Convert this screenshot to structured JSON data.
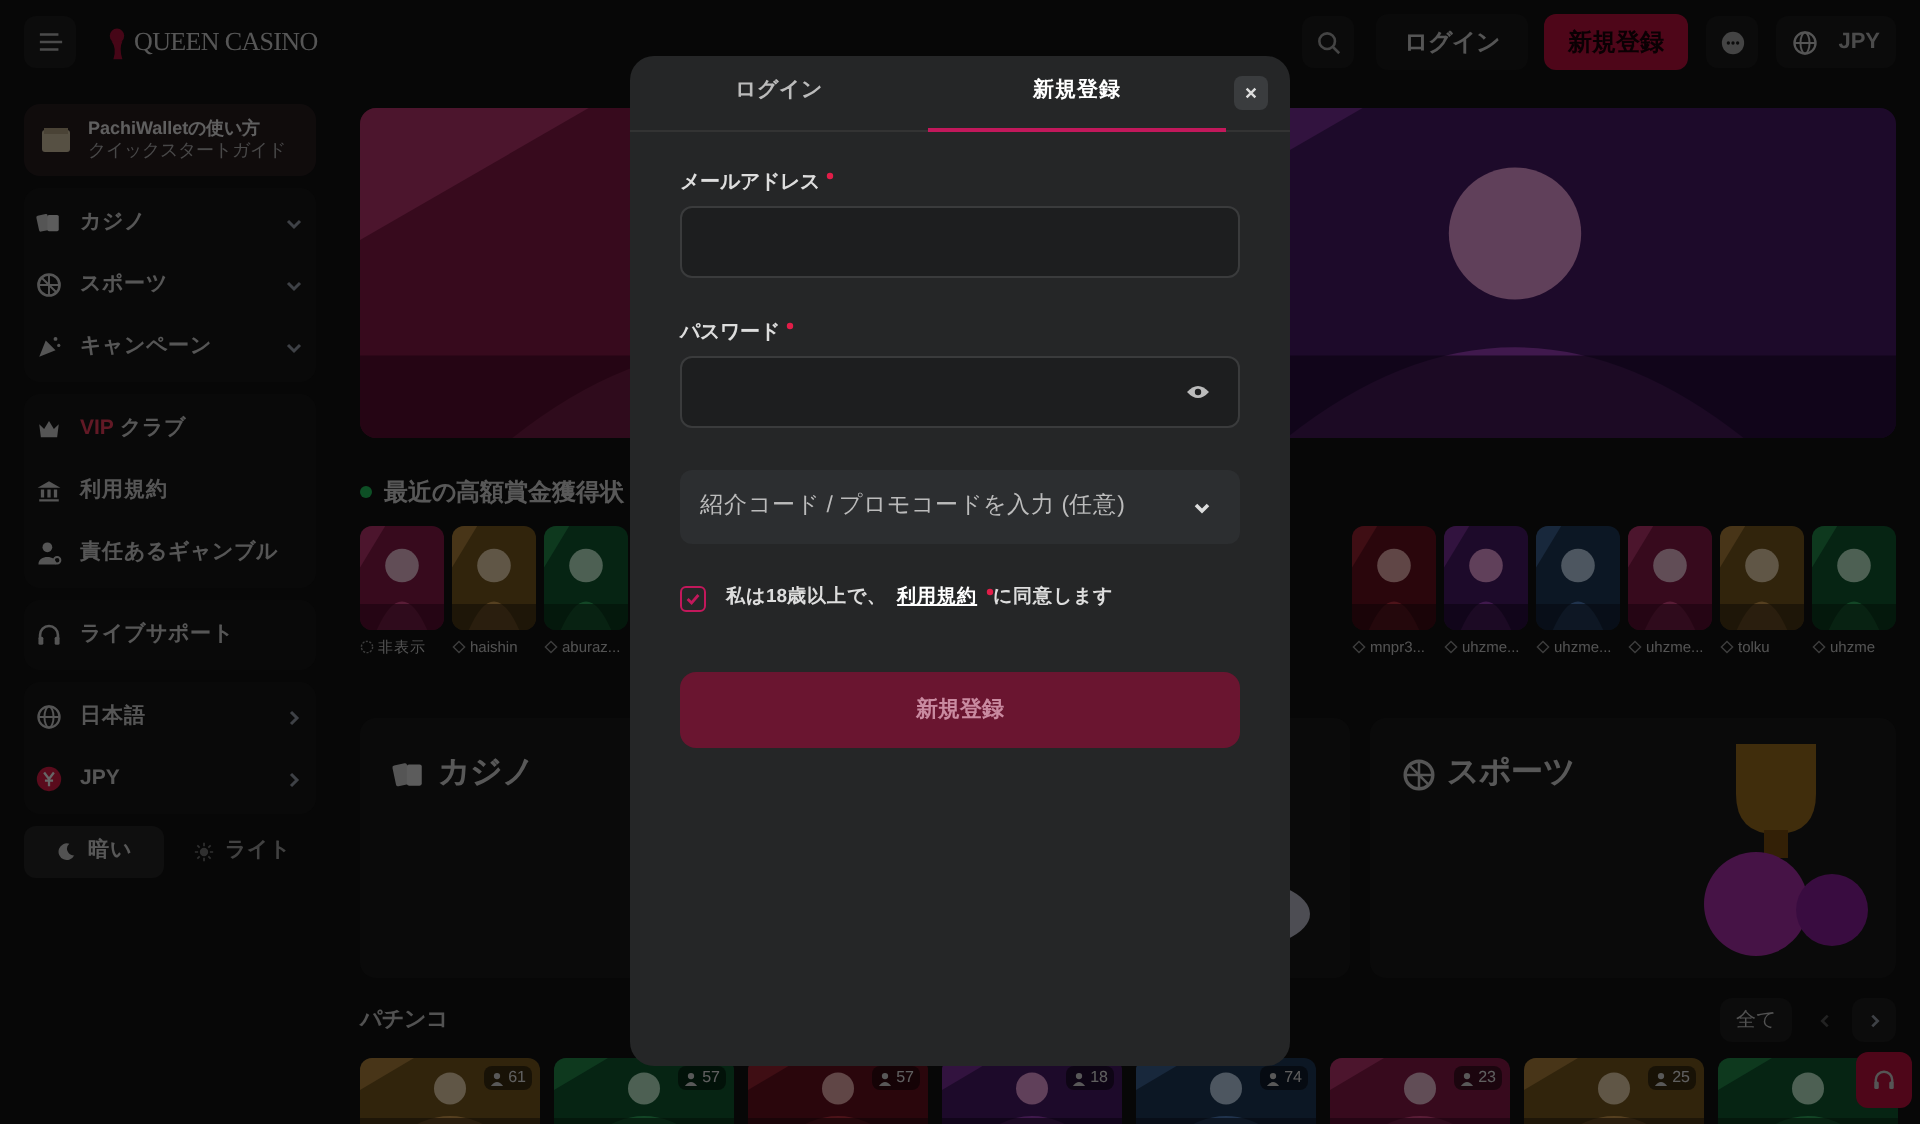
{
  "header": {
    "logo": "QUEEN CASINO",
    "login_button": "ログイン",
    "signup_button": "新規登録",
    "currency": "JPY"
  },
  "sidebar": {
    "promo": {
      "title": "PachiWalletの使い方",
      "subtitle": "クイックスタートガイド"
    },
    "groups": [
      [
        {
          "label": "カジノ",
          "kind": "dropdown"
        },
        {
          "label": "スポーツ",
          "kind": "dropdown"
        },
        {
          "label": "キャンペーン",
          "kind": "dropdown"
        }
      ],
      [
        {
          "badge": "VIP",
          "label": "クラブ",
          "kind": "plain"
        },
        {
          "label": "利用規約",
          "kind": "plain"
        },
        {
          "label": "責任あるギャンブル",
          "kind": "plain"
        }
      ],
      [
        {
          "label": "ライブサポート",
          "kind": "plain"
        }
      ],
      [
        {
          "label": "日本語",
          "kind": "submenu"
        },
        {
          "label": "JPY",
          "kind": "submenu"
        }
      ]
    ],
    "theme_toggle": [
      {
        "label": "暗い",
        "selected": true
      },
      {
        "label": "ライト",
        "selected": false
      }
    ]
  },
  "main": {
    "winners_title": "最近の高額賞金獲得状",
    "winners_left": [
      {
        "user": "非表示",
        "kind": "anonymous"
      },
      {
        "user": "haishin",
        "kind": "user"
      },
      {
        "user": "aburaz...",
        "kind": "user"
      }
    ],
    "winners_right": [
      {
        "user": "mnpr3...",
        "kind": "user"
      },
      {
        "user": "uhzme...",
        "kind": "user"
      },
      {
        "user": "uhzme...",
        "kind": "user"
      },
      {
        "user": "uhzme...",
        "kind": "user"
      },
      {
        "user": "tolku",
        "kind": "user"
      },
      {
        "user": "uhzme",
        "kind": "user"
      }
    ],
    "categories": [
      {
        "label": "カジノ"
      },
      {
        "label": "スポーツ"
      }
    ],
    "pachinko": {
      "title": "パチンコ",
      "all_button": "全て",
      "games": [
        {
          "players": "61"
        },
        {
          "players": "57"
        },
        {
          "players": "57"
        },
        {
          "players": "18"
        },
        {
          "players": "74"
        },
        {
          "players": "23"
        },
        {
          "players": "25"
        }
      ]
    }
  },
  "modal": {
    "tabs": [
      {
        "label": "ログイン",
        "selected": false
      },
      {
        "label": "新規登録",
        "selected": true
      }
    ],
    "fields": [
      {
        "label": "メールアドレス",
        "required": true,
        "kind": "email"
      },
      {
        "label": "パスワード",
        "required": true,
        "kind": "password"
      }
    ],
    "promo_code": {
      "placeholder": "紹介コード / プロモコードを入力 (任意)"
    },
    "agreement": {
      "checked": true,
      "before": "私は18歳以上で、",
      "link": "利用規約",
      "required": true,
      "after": "に同意します"
    },
    "submit": {
      "label": "新規登録",
      "disabled": true
    }
  }
}
